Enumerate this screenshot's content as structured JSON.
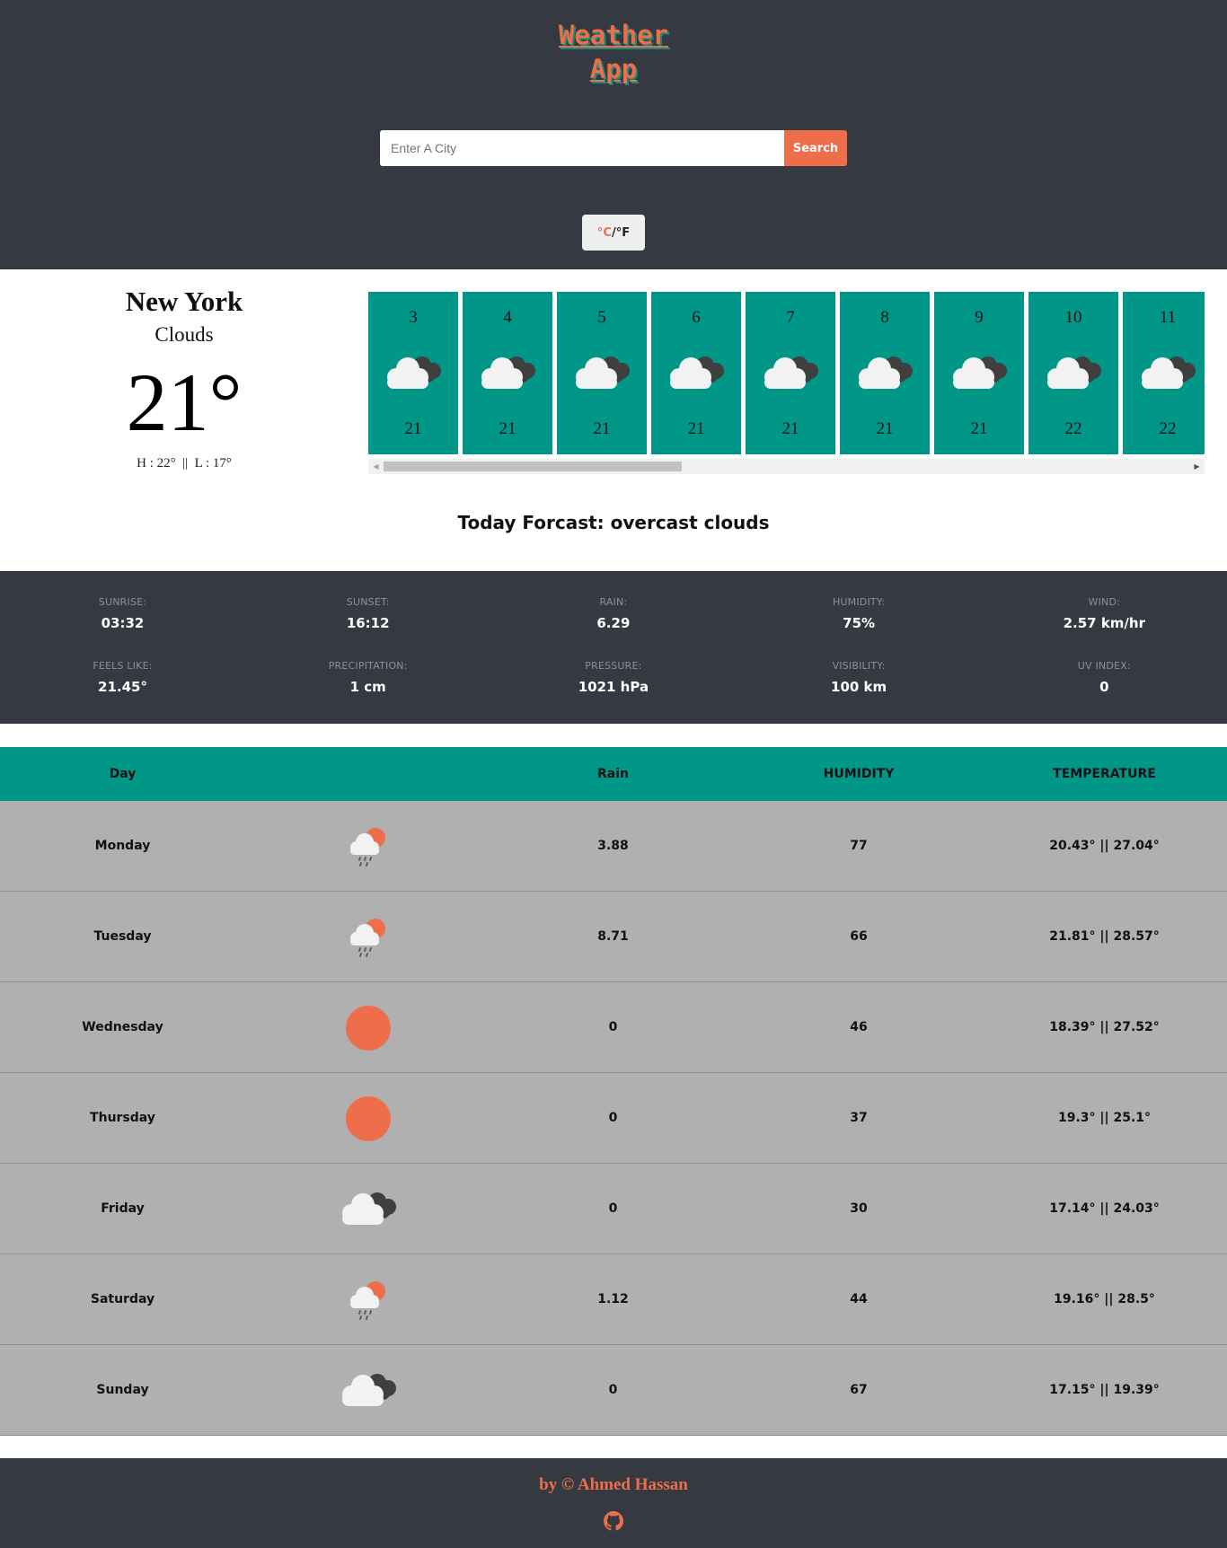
{
  "header": {
    "title_line1": "Weather",
    "title_line2": "App",
    "search_placeholder": "Enter A City",
    "search_label": "Search",
    "unit_c": "°C",
    "unit_sep": "/°F"
  },
  "current": {
    "city": "New York",
    "condition": "Clouds",
    "temperature": "21°",
    "high_low": "H : 22°  ||  L : 17°",
    "today_forecast": "Today Forcast: overcast clouds"
  },
  "hourly": [
    {
      "time": "3",
      "temp": "21",
      "icon": "cloudy-icon"
    },
    {
      "time": "4",
      "temp": "21",
      "icon": "cloudy-icon"
    },
    {
      "time": "5",
      "temp": "21",
      "icon": "cloudy-icon"
    },
    {
      "time": "6",
      "temp": "21",
      "icon": "cloudy-icon"
    },
    {
      "time": "7",
      "temp": "21",
      "icon": "cloudy-icon"
    },
    {
      "time": "8",
      "temp": "21",
      "icon": "cloudy-icon"
    },
    {
      "time": "9",
      "temp": "21",
      "icon": "cloudy-icon"
    },
    {
      "time": "10",
      "temp": "22",
      "icon": "cloudy-icon"
    },
    {
      "time": "11",
      "temp": "22",
      "icon": "cloudy-icon"
    }
  ],
  "details": [
    {
      "label": "SUNRISE:",
      "value": "03:32"
    },
    {
      "label": "SUNSET:",
      "value": "16:12"
    },
    {
      "label": "RAIN:",
      "value": "6.29"
    },
    {
      "label": "HUMIDITY:",
      "value": "75%"
    },
    {
      "label": "WIND:",
      "value": "2.57 km/hr"
    },
    {
      "label": "FEELS LIKE:",
      "value": "21.45°"
    },
    {
      "label": "PRECIPITATION:",
      "value": "1 cm"
    },
    {
      "label": "PRESSURE:",
      "value": "1021 hPa"
    },
    {
      "label": "VISIBILITY:",
      "value": "100 km"
    },
    {
      "label": "UV INDEX:",
      "value": "0"
    }
  ],
  "daily_headers": {
    "day": "Day",
    "rain": "Rain",
    "humidity": "HUMIDITY",
    "temperature": "TEMPERATURE"
  },
  "daily": [
    {
      "day": "Monday",
      "icon": "sun-rain-icon",
      "rain": "3.88",
      "humidity": "77",
      "temp": "20.43° || 27.04°"
    },
    {
      "day": "Tuesday",
      "icon": "sun-rain-icon",
      "rain": "8.71",
      "humidity": "66",
      "temp": "21.81° || 28.57°"
    },
    {
      "day": "Wednesday",
      "icon": "sun-icon",
      "rain": "0",
      "humidity": "46",
      "temp": "18.39° || 27.52°"
    },
    {
      "day": "Thursday",
      "icon": "sun-icon",
      "rain": "0",
      "humidity": "37",
      "temp": "19.3° || 25.1°"
    },
    {
      "day": "Friday",
      "icon": "cloudy-icon",
      "rain": "0",
      "humidity": "30",
      "temp": "17.14° || 24.03°"
    },
    {
      "day": "Saturday",
      "icon": "sun-rain-icon",
      "rain": "1.12",
      "humidity": "44",
      "temp": "19.16° || 28.5°"
    },
    {
      "day": "Sunday",
      "icon": "cloudy-icon",
      "rain": "0",
      "humidity": "67",
      "temp": "17.15° || 19.39°"
    }
  ],
  "footer": {
    "credit": "by © Ahmed Hassan",
    "github_icon": "github-icon"
  },
  "colors": {
    "dark": "#353a42",
    "accent": "#ee6e4c",
    "teal": "#009688",
    "table_bg": "#b0b0b0"
  }
}
